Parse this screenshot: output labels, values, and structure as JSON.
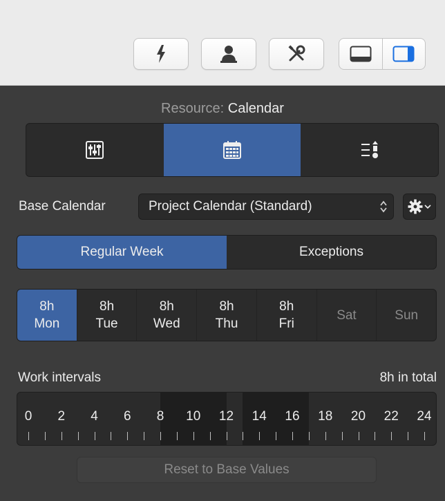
{
  "toolbar": {
    "buttons": [
      {
        "icon": "lightning-icon"
      },
      {
        "icon": "person-icon"
      },
      {
        "icon": "tools-icon"
      }
    ],
    "view_toggles": [
      {
        "icon": "bottom-panel-icon"
      },
      {
        "icon": "right-panel-icon",
        "active": true
      }
    ]
  },
  "inspector": {
    "title_key": "Resource:",
    "title_value": "Calendar",
    "tabs": [
      {
        "icon": "sliders-icon"
      },
      {
        "icon": "calendar-icon",
        "active": true
      },
      {
        "icon": "list-priority-icon"
      }
    ],
    "base_calendar": {
      "label": "Base Calendar",
      "value": "Project Calendar (Standard)",
      "arrows": "◇"
    },
    "week_tabs": [
      {
        "label": "Regular Week",
        "active": true
      },
      {
        "label": "Exceptions",
        "active": false
      }
    ],
    "days": [
      {
        "hours": "8h",
        "name": "Mon",
        "active": true
      },
      {
        "hours": "8h",
        "name": "Tue"
      },
      {
        "hours": "8h",
        "name": "Wed"
      },
      {
        "hours": "8h",
        "name": "Thu"
      },
      {
        "hours": "8h",
        "name": "Fri"
      },
      {
        "hours": "",
        "name": "Sat",
        "off": true
      },
      {
        "hours": "",
        "name": "Sun",
        "off": true
      }
    ],
    "work_intervals": {
      "label": "Work intervals",
      "total": "8h in total",
      "hour_labels": [
        "0",
        "2",
        "4",
        "6",
        "8",
        "10",
        "12",
        "14",
        "16",
        "18",
        "20",
        "22",
        "24"
      ],
      "intervals": [
        {
          "start": 8,
          "end": 12
        },
        {
          "start": 13,
          "end": 17
        }
      ]
    },
    "reset_label": "Reset to Base Values"
  },
  "colors": {
    "accent": "#3d64a3",
    "panel_bg": "#3c3c3c",
    "toolbar_bg": "#ebebeb"
  }
}
